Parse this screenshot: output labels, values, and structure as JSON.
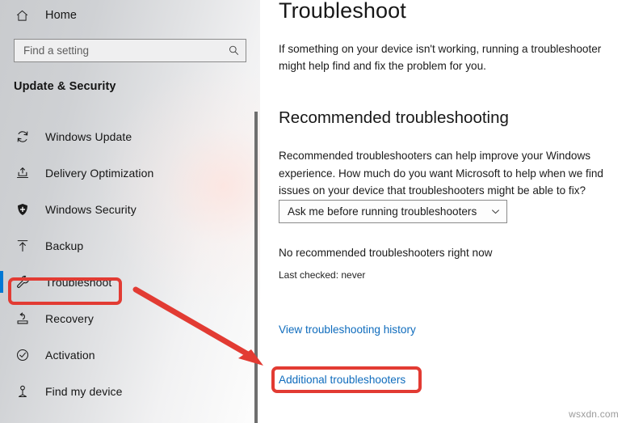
{
  "sidebar": {
    "home": {
      "label": "Home",
      "icon": "home-icon"
    },
    "search": {
      "value": "",
      "placeholder": "Find a setting",
      "icon": "search-icon"
    },
    "section_title": "Update & Security",
    "items": [
      {
        "label": "Windows Update",
        "icon": "refresh-icon",
        "selected": false
      },
      {
        "label": "Delivery Optimization",
        "icon": "delivery-upload-icon",
        "selected": false
      },
      {
        "label": "Windows Security",
        "icon": "shield-icon",
        "selected": false
      },
      {
        "label": "Backup",
        "icon": "upload-arrow-icon",
        "selected": false
      },
      {
        "label": "Troubleshoot",
        "icon": "wrench-icon",
        "selected": true
      },
      {
        "label": "Recovery",
        "icon": "recovery-icon",
        "selected": false
      },
      {
        "label": "Activation",
        "icon": "check-circle-icon",
        "selected": false
      },
      {
        "label": "Find my device",
        "icon": "find-device-icon",
        "selected": false
      }
    ]
  },
  "content": {
    "title": "Troubleshoot",
    "intro": "If something on your device isn't working, running a troubleshooter might help find and fix the problem for you.",
    "recommended_heading": "Recommended troubleshooting",
    "recommended_text": "Recommended troubleshooters can help improve your Windows experience. How much do you want Microsoft to help when we find issues on your device that troubleshooters might be able to fix?",
    "dropdown": {
      "value": "Ask me before running troubleshooters",
      "icon": "chevron-down-icon",
      "options": [
        "Ask me before running troubleshooters"
      ]
    },
    "no_recommendations": "No recommended troubleshooters right now",
    "last_checked": "Last checked: never",
    "link_history": "View troubleshooting history",
    "link_additional": "Additional troubleshooters"
  },
  "annotations": {
    "highlight_color": "#e23b33",
    "arrow_color": "#e23b33",
    "boxes": [
      {
        "name": "troubleshoot-sidebar-highlight"
      },
      {
        "name": "additional-troubleshooters-highlight"
      }
    ]
  },
  "watermark": "wsxdn.com",
  "theme": {
    "accent": "#0078d4",
    "link": "#0f6cbd",
    "sidebar_bg": "#d8d9db",
    "content_bg": "#ffffff"
  }
}
